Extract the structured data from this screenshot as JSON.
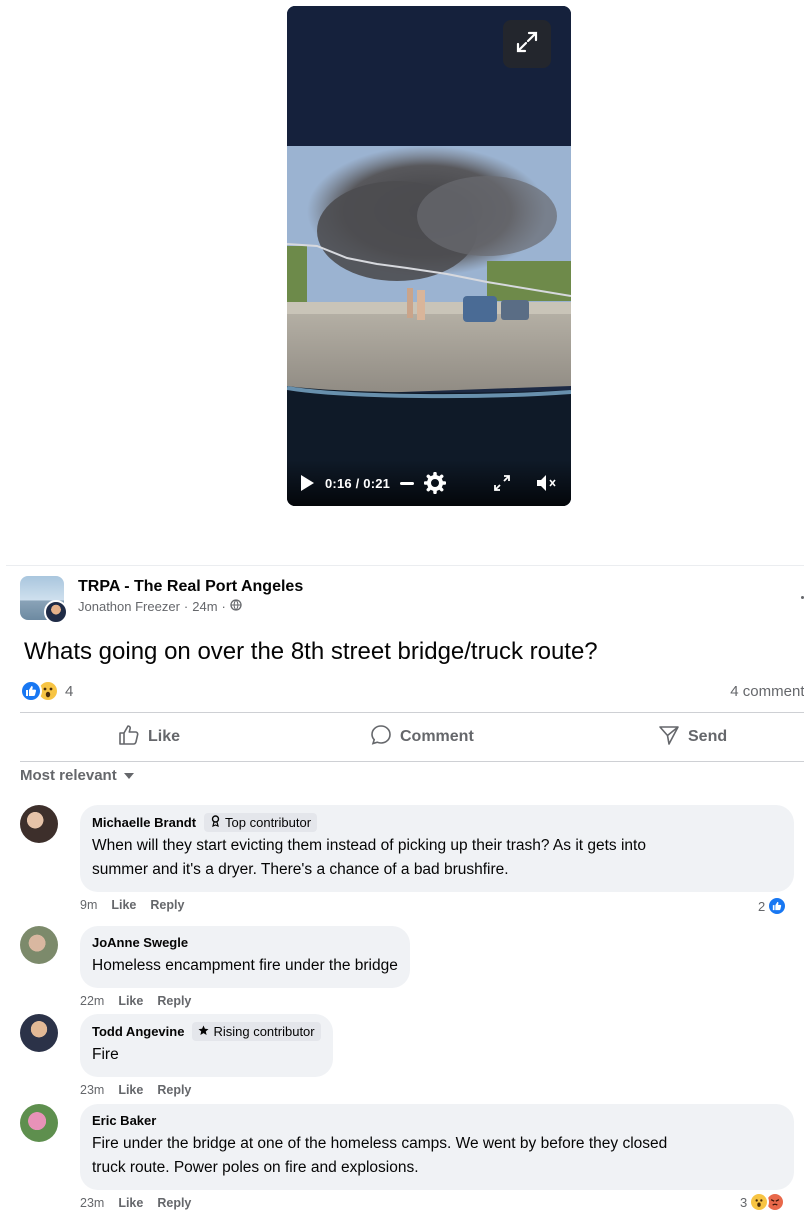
{
  "video": {
    "current_time": "0:16",
    "separator": " / ",
    "duration": "0:21",
    "progress_fraction": 0.76
  },
  "post": {
    "group_name": "TRPA - The Real Port Angeles",
    "author": "Jonathon Freezer",
    "dot": " · ",
    "time": "24m",
    "text": "Whats going on over the 8th street bridge/truck route?",
    "reaction_count": "4",
    "comments_label": "4 comments",
    "reactions": [
      "like",
      "wow"
    ]
  },
  "actions": {
    "like": "Like",
    "comment": "Comment",
    "send": "Send"
  },
  "sort_label": "Most relevant",
  "comments": [
    {
      "name": "Michaelle Brandt",
      "badge": "Top contributor",
      "text_line1": "When will they start evicting them instead of picking up their trash? As it gets into",
      "text_line2": "summer and it's a dryer. There's a chance of a bad brushfire.",
      "time": "9m",
      "like": "Like",
      "reply": "Reply",
      "reaction_count": "2",
      "reactions": [
        "like"
      ]
    },
    {
      "name": "JoAnne Swegle",
      "text": "Homeless encampment fire under the bridge",
      "time": "22m",
      "like": "Like",
      "reply": "Reply"
    },
    {
      "name": "Todd Angevine",
      "badge": "Rising contributor",
      "text": "Fire",
      "time": "23m",
      "like": "Like",
      "reply": "Reply"
    },
    {
      "name": "Eric Baker",
      "text_line1": "Fire under the bridge at one of the homeless camps. We went by before they closed",
      "text_line2": "truck route. Power poles on fire and explosions.",
      "time": "23m",
      "like": "Like",
      "reply": "Reply",
      "reaction_count": "3",
      "reactions": [
        "wow",
        "angry"
      ]
    }
  ],
  "colors": {
    "brand_blue": "#1877f2",
    "secondary_text": "#65676b",
    "bubble_bg": "#f0f2f5"
  }
}
